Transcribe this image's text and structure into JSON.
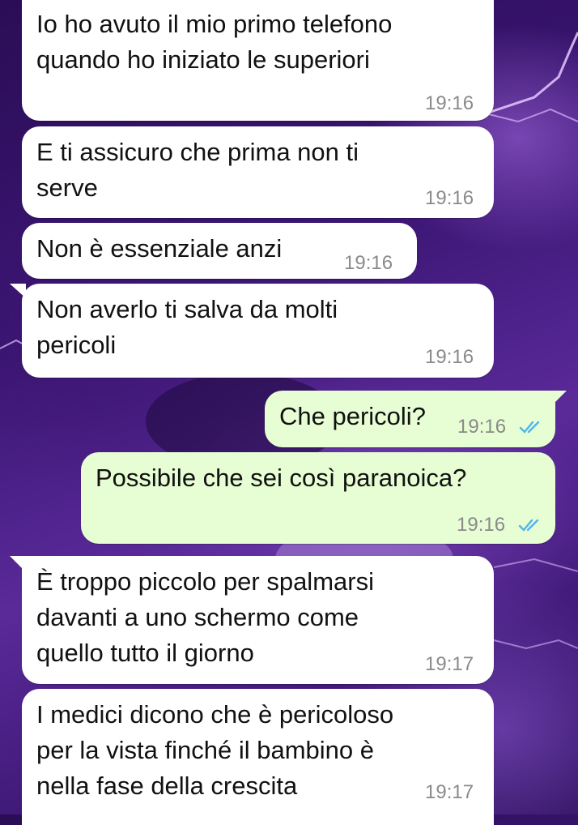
{
  "conversation": {
    "messages": [
      {
        "direction": "in",
        "text": "Io ho avuto il mio primo telefono\nquando ho iniziato le superiori",
        "time": "19:16"
      },
      {
        "direction": "in",
        "text": "E ti assicuro che prima non ti\nserve",
        "time": "19:16"
      },
      {
        "direction": "in",
        "text": "Non è essenziale anzi",
        "time": "19:16"
      },
      {
        "direction": "in",
        "text": "Non averlo ti salva da molti\npericoli",
        "time": "19:16"
      },
      {
        "direction": "out",
        "text": "Che pericoli?",
        "time": "19:16",
        "status": "read"
      },
      {
        "direction": "out",
        "text": "Possibile che sei così paranoica?",
        "time": "19:16",
        "status": "read"
      },
      {
        "direction": "in",
        "text": "È troppo piccolo per spalmarsi\ndavanti a uno schermo come\nquello tutto il giorno",
        "time": "19:17"
      },
      {
        "direction": "in",
        "text": "I medici dicono che è pericoloso\nper la vista finché il bambino è\nnella fase della crescita",
        "time": "19:17"
      }
    ]
  },
  "colors": {
    "incoming_bubble": "#ffffff",
    "outgoing_bubble": "#e7fdd3",
    "read_ticks": "#4fb6ec",
    "timestamp": "#8a8a8a"
  },
  "icons": {
    "read_status": "double-check-icon"
  }
}
